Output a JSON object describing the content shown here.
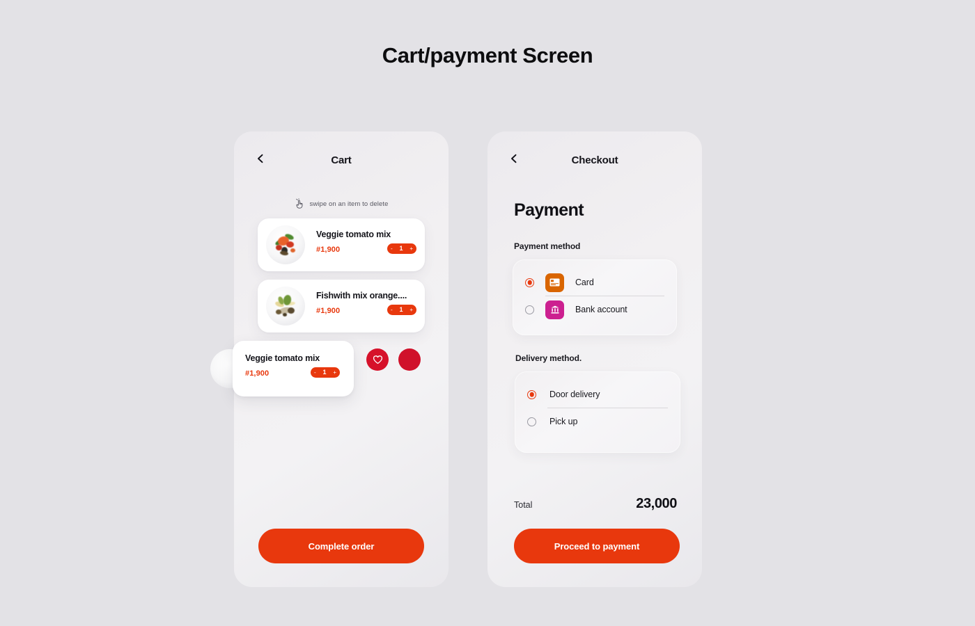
{
  "page": {
    "title": "Cart/payment Screen",
    "background_color": "#e3e2e6",
    "accent_color": "#e8380d"
  },
  "cart_screen": {
    "header": {
      "back_icon": "chevron-left-icon",
      "title": "Cart"
    },
    "swipe_hint": {
      "icon": "swipe-hand-icon",
      "text": "swipe on an item to delete"
    },
    "items": [
      {
        "name": "Veggie tomato mix",
        "price": "#1,900",
        "quantity": "1",
        "decrement": "-",
        "increment": "+",
        "image": "veggie-tomato-plate"
      },
      {
        "name": "Fishwith mix orange....",
        "price": "#1,900",
        "quantity": "1",
        "decrement": "-",
        "increment": "+",
        "image": "fish-mix-plate"
      }
    ],
    "swiped_item": {
      "name": "Veggie tomato mix",
      "price": "#1,900",
      "quantity": "1",
      "decrement": "-",
      "increment": "+",
      "image": "veggie-tomato-plate",
      "actions": [
        {
          "name": "favorite",
          "icon": "heart-icon",
          "color": "#d6112a"
        },
        {
          "name": "delete",
          "icon": "delete-icon",
          "color": "#d0112a"
        }
      ]
    },
    "complete_order_label": "Complete order"
  },
  "checkout_screen": {
    "header": {
      "back_icon": "chevron-left-icon",
      "title": "Checkout"
    },
    "page_heading": "Payment",
    "payment_method": {
      "label": "Payment method",
      "options": [
        {
          "label": "Card",
          "icon": "credit-card-icon",
          "icon_color": "#d96500",
          "selected": true
        },
        {
          "label": "Bank account",
          "icon": "bank-building-icon",
          "icon_color": "#cc2090",
          "selected": false
        }
      ]
    },
    "delivery_method": {
      "label": "Delivery method.",
      "options": [
        {
          "label": "Door delivery",
          "selected": true
        },
        {
          "label": "Pick up",
          "selected": false
        }
      ]
    },
    "total": {
      "label": "Total",
      "value": "23,000"
    },
    "proceed_label": "Proceed to payment"
  }
}
